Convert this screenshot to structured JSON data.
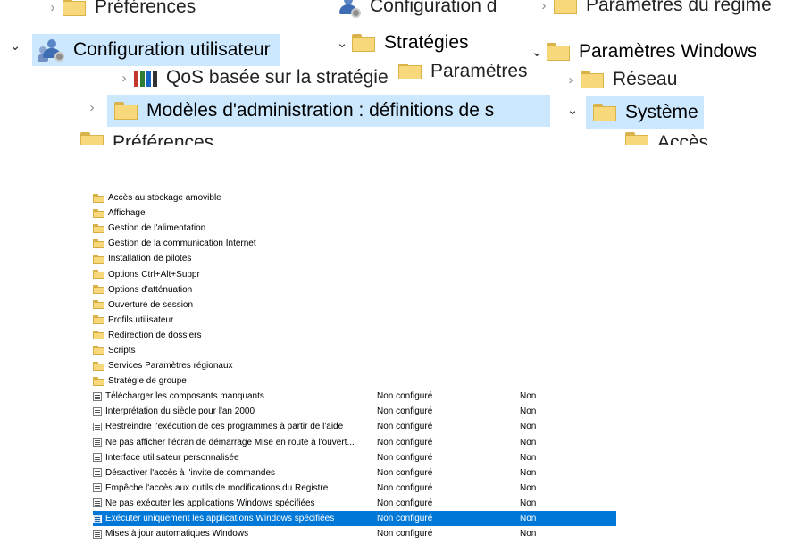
{
  "colors": {
    "selection_light": "#cce8ff",
    "selection_dark": "#0078d7",
    "folder": "#f7d87a"
  },
  "breadcrumb": {
    "prefs_top": "Préférences",
    "config_ordinateur_partial": "Configuration d",
    "parametres_regionaux_partial": "Paramètres du régime",
    "config_utilisateur": "Configuration utilisateur",
    "strategies": "Stratégies",
    "parametres_windows": "Paramètres Windows",
    "qos": "QoS basée sur la stratégie",
    "parametres_partial": "Paramètres",
    "reseau": "Réseau",
    "modeles_admin": "Modèles d'administration : définitions de s",
    "systeme": "Système",
    "prefs_bottom": "Préférences",
    "acces_partial": "Accès"
  },
  "folders": [
    "Accès au stockage amovible",
    "Affichage",
    "Gestion de l'alimentation",
    "Gestion de la communication Internet",
    "Installation de pilotes",
    "Options Ctrl+Alt+Suppr",
    "Options d'atténuation",
    "Ouverture de session",
    "Profils utilisateur",
    "Redirection de dossiers",
    "Scripts",
    "Services Paramètres régionaux",
    "Stratégie de groupe"
  ],
  "settings": [
    {
      "name": "Télécharger les composants manquants",
      "state": "Non configuré",
      "comment": "Non"
    },
    {
      "name": "Interprétation du siècle pour l'an 2000",
      "state": "Non configuré",
      "comment": "Non"
    },
    {
      "name": "Restreindre l'exécution de ces programmes à partir de l'aide",
      "state": "Non configuré",
      "comment": "Non"
    },
    {
      "name": "Ne pas afficher l'écran de démarrage Mise en route à l'ouvert...",
      "state": "Non configuré",
      "comment": "Non"
    },
    {
      "name": "Interface utilisateur personnalisée",
      "state": "Non configuré",
      "comment": "Non"
    },
    {
      "name": "Désactiver l'accès à l'invite de commandes",
      "state": "Non configuré",
      "comment": "Non"
    },
    {
      "name": "Empêche l'accès aux outils de modifications du Registre",
      "state": "Non configuré",
      "comment": "Non"
    },
    {
      "name": "Ne pas exécuter les applications Windows spécifiées",
      "state": "Non configuré",
      "comment": "Non"
    },
    {
      "name": "Exécuter uniquement les applications Windows spécifiées",
      "state": "Non configuré",
      "comment": "Non",
      "selected": true
    },
    {
      "name": "Mises à jour automatiques Windows",
      "state": "Non configuré",
      "comment": "Non"
    }
  ]
}
